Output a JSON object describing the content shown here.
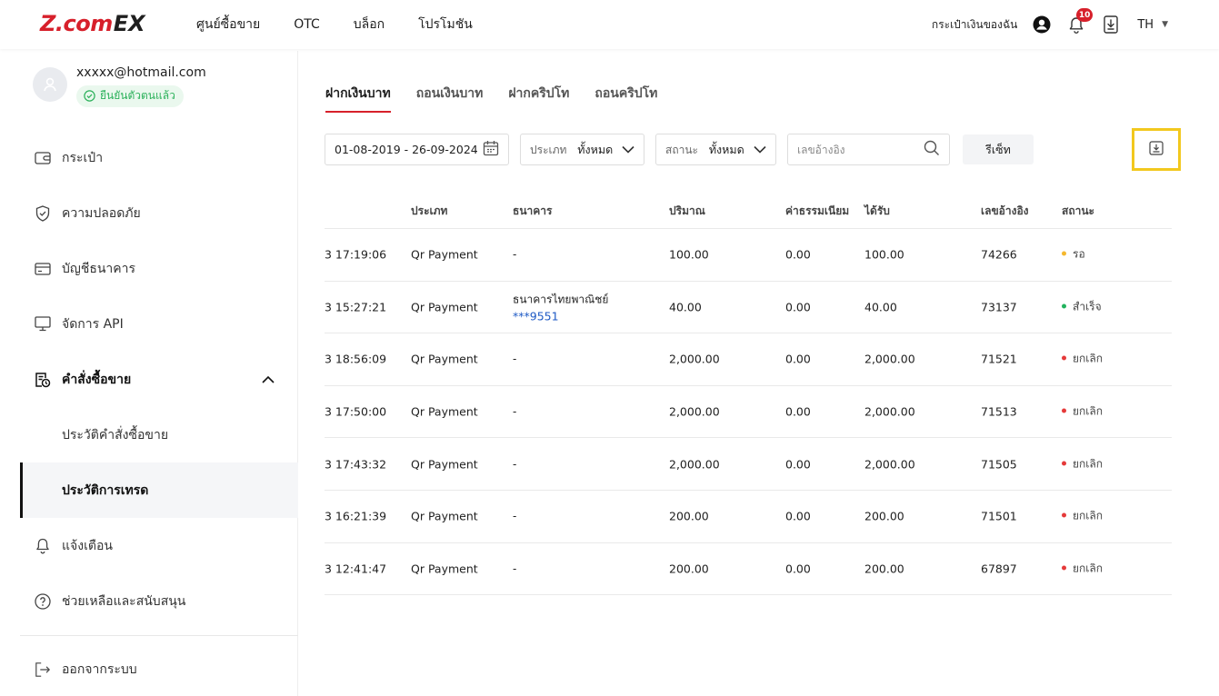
{
  "brand": {
    "logo_main": "Z.com",
    "logo_suffix": "EX"
  },
  "topnav": {
    "items": [
      "ศูนย์ซื้อขาย",
      "OTC",
      "บล็อก",
      "โปรโมชัน"
    ]
  },
  "topright": {
    "wallet_label": "กระเป๋าเงินของฉัน",
    "notification_count": "10",
    "language": "TH"
  },
  "profile": {
    "email": "xxxxx@hotmail.com",
    "verified_label": "ยืนยันตัวตนแล้ว"
  },
  "sidebar": {
    "wallet": "กระเป๋า",
    "security": "ความปลอดภัย",
    "bank_account": "บัญชีธนาคาร",
    "api": "จัดการ API",
    "orders": "คำสั่งซื้อขาย",
    "order_history": "ประวัติคำสั่งซื้อขาย",
    "trade_history": "ประวัติการเทรด",
    "notifications": "แจ้งเตือน",
    "help": "ช่วยเหลือและสนับสนุน",
    "logout": "ออกจากระบบ"
  },
  "tabs": [
    "ฝากเงินบาท",
    "ถอนเงินบาท",
    "ฝากคริปโท",
    "ถอนคริปโท"
  ],
  "filters": {
    "date_range": "01-08-2019 - 26-09-2024",
    "type_label": "ประเภท",
    "type_value": "ทั้งหมด",
    "status_label": "สถานะ",
    "status_value": "ทั้งหมด",
    "ref_placeholder": "เลขอ้างอิง",
    "reset_label": "รีเซ็ท"
  },
  "table": {
    "headers": {
      "type": "ประเภท",
      "bank": "ธนาคาร",
      "amount": "ปริมาณ",
      "fee": "ค่าธรรมเนียม",
      "received": "ได้รับ",
      "ref": "เลขอ้างอิง",
      "status": "สถานะ"
    },
    "rows": [
      {
        "time": "3  17:19:06",
        "type": "Qr Payment",
        "bank": "-",
        "bank_acct": "",
        "amount": "100.00",
        "fee": "0.00",
        "received": "100.00",
        "ref": "74266",
        "status": "รอ",
        "status_color": "#f5b82e"
      },
      {
        "time": "3  15:27:21",
        "type": "Qr Payment",
        "bank": "ธนาคารไทยพาณิชย์",
        "bank_acct": "***9551",
        "amount": "40.00",
        "fee": "0.00",
        "received": "40.00",
        "ref": "73137",
        "status": "สำเร็จ",
        "status_color": "#22b35e"
      },
      {
        "time": "3  18:56:09",
        "type": "Qr Payment",
        "bank": "-",
        "bank_acct": "",
        "amount": "2,000.00",
        "fee": "0.00",
        "received": "2,000.00",
        "ref": "71521",
        "status": "ยกเลิก",
        "status_color": "#e53a3a"
      },
      {
        "time": "3  17:50:00",
        "type": "Qr Payment",
        "bank": "-",
        "bank_acct": "",
        "amount": "2,000.00",
        "fee": "0.00",
        "received": "2,000.00",
        "ref": "71513",
        "status": "ยกเลิก",
        "status_color": "#e53a3a"
      },
      {
        "time": "3  17:43:32",
        "type": "Qr Payment",
        "bank": "-",
        "bank_acct": "",
        "amount": "2,000.00",
        "fee": "0.00",
        "received": "2,000.00",
        "ref": "71505",
        "status": "ยกเลิก",
        "status_color": "#e53a3a"
      },
      {
        "time": "3  16:21:39",
        "type": "Qr Payment",
        "bank": "-",
        "bank_acct": "",
        "amount": "200.00",
        "fee": "0.00",
        "received": "200.00",
        "ref": "71501",
        "status": "ยกเลิก",
        "status_color": "#e53a3a"
      },
      {
        "time": "3  12:41:47",
        "type": "Qr Payment",
        "bank": "-",
        "bank_acct": "",
        "amount": "200.00",
        "fee": "0.00",
        "received": "200.00",
        "ref": "67897",
        "status": "ยกเลิก",
        "status_color": "#e53a3a"
      }
    ]
  },
  "colors": {
    "brand_red": "#d7202b",
    "highlight": "#f2c81e",
    "link_blue": "#1f5ac5"
  },
  "icons": [
    "user-icon",
    "bell-icon",
    "download-icon",
    "wallet-icon",
    "shield-icon",
    "card-icon",
    "monitor-icon",
    "order-icon",
    "bell-icon",
    "help-icon",
    "logout-icon",
    "calendar-icon",
    "search-icon",
    "export-icon"
  ]
}
